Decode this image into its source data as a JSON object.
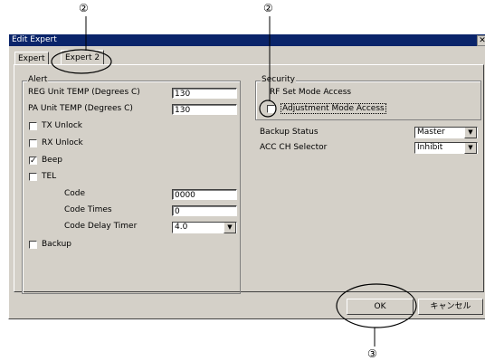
{
  "callouts": {
    "top_left": "②",
    "top_right": "②",
    "bottom": "③"
  },
  "window": {
    "title": "Edit Expert",
    "close_glyph": "✕"
  },
  "tabs": [
    {
      "label": "Expert"
    },
    {
      "label": "Expert 2"
    }
  ],
  "alert": {
    "group_label": "Alert",
    "reg_unit_temp": {
      "label": "REG Unit TEMP (Degrees C)",
      "value": "130"
    },
    "pa_unit_temp": {
      "label": "PA Unit TEMP (Degrees C)",
      "value": "130"
    },
    "tx_unlock": {
      "label": "TX Unlock",
      "checked": false
    },
    "rx_unlock": {
      "label": "RX Unlock",
      "checked": false
    },
    "beep": {
      "label": "Beep",
      "checked": true,
      "mark": "✓"
    },
    "tel": {
      "label": "TEL",
      "checked": false
    },
    "code": {
      "label": "Code",
      "value": "0000"
    },
    "code_times": {
      "label": "Code Times",
      "value": "0"
    },
    "code_delay_timer": {
      "label": "Code Delay Timer",
      "value": "4.0"
    },
    "backup": {
      "label": "Backup",
      "checked": false
    }
  },
  "security": {
    "group_label": "Security",
    "rf_set_mode": {
      "label": "RF Set Mode Access"
    },
    "adjustment_mode": {
      "label": "Adjustment Mode Access",
      "checked": false
    },
    "backup_status": {
      "label": "Backup Status",
      "value": "Master"
    },
    "acc_ch_selector": {
      "label": "ACC CH Selector",
      "value": "Inhibit"
    }
  },
  "buttons": {
    "ok": "OK",
    "cancel": "キャンセル"
  },
  "dropdown_arrow": "▼"
}
